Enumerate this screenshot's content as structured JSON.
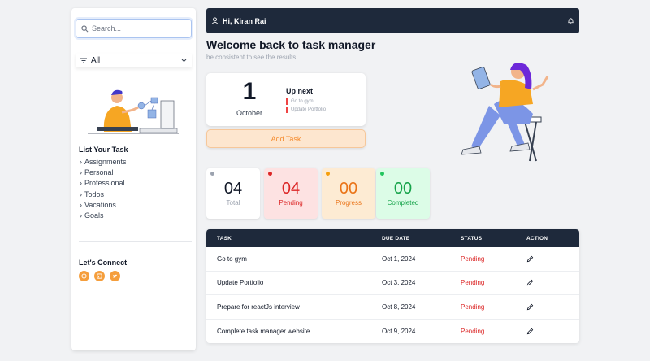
{
  "sidebar": {
    "search_placeholder": "Search...",
    "filter_value": "All",
    "list_title": "List Your Task",
    "items": [
      {
        "label": "Assignments"
      },
      {
        "label": "Personal"
      },
      {
        "label": "Professional"
      },
      {
        "label": "Todos"
      },
      {
        "label": "Vacations"
      },
      {
        "label": "Goals"
      }
    ],
    "connect_title": "Let's Connect",
    "socials": [
      "github-icon",
      "linkedin-icon",
      "twitter-icon"
    ]
  },
  "header": {
    "greeting": "Hi, Kiran Rai",
    "user_icon": "user-icon",
    "bell_icon": "bell-icon"
  },
  "main": {
    "welcome": "Welcome back to task manager",
    "subtitle": "be consistent to see the results",
    "date": {
      "day": "1",
      "month": "October"
    },
    "up_next": {
      "title": "Up next",
      "items": [
        "Go to gym",
        "Update Portfolio"
      ]
    },
    "add_task_label": "Add Task"
  },
  "stats": [
    {
      "value": "04",
      "label": "Total",
      "color": "#111827",
      "bg": "#ffffff",
      "dot": "#9ca3af"
    },
    {
      "value": "04",
      "label": "Pending",
      "color": "#dc2626",
      "bg": "#fde2e2",
      "dot": "#dc2626"
    },
    {
      "value": "00",
      "label": "Progress",
      "color": "#ea7317",
      "bg": "#fdebd3",
      "dot": "#f59e0b"
    },
    {
      "value": "00",
      "label": "Completed",
      "color": "#16a34a",
      "bg": "#dcfce7",
      "dot": "#22c55e"
    }
  ],
  "table": {
    "headers": {
      "task": "TASK",
      "due": "DUE DATE",
      "status": "STATUS",
      "action": "ACTION"
    },
    "rows": [
      {
        "task": "Go to gym",
        "due": "Oct 1, 2024",
        "status": "Pending"
      },
      {
        "task": "Update Portfolio",
        "due": "Oct 3, 2024",
        "status": "Pending"
      },
      {
        "task": "Prepare for reactJs interview",
        "due": "Oct 8, 2024",
        "status": "Pending"
      },
      {
        "task": "Complete task manager website",
        "due": "Oct 9, 2024",
        "status": "Pending"
      }
    ]
  },
  "colors": {
    "accent": "#f59e3c",
    "dark": "#1e293b",
    "pending": "#dc2626"
  }
}
